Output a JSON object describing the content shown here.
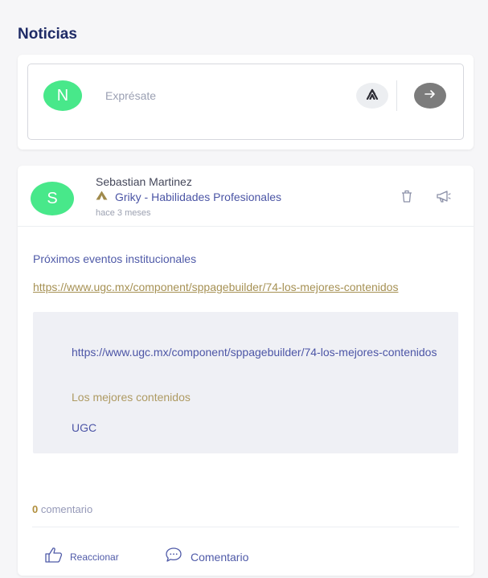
{
  "feed": {
    "title": "Noticias"
  },
  "composer": {
    "avatar_initial": "N",
    "avatar_color": "#48e88a",
    "placeholder": "Exprésate"
  },
  "post": {
    "avatar_initial": "S",
    "avatar_color": "#48e88a",
    "author": "Sebastian Martinez",
    "group": "Griky - Habilidades Profesionales",
    "time": "hace 3 meses",
    "text": "Próximos eventos institucionales",
    "link": "https://www.ugc.mx/component/sppagebuilder/74-los-mejores-contenidos",
    "preview": {
      "url": "https://www.ugc.mx/component/sppagebuilder/74-los-mejores-contenidos",
      "title": "Los mejores contenidos",
      "site": "UGC"
    },
    "comments": {
      "count": "0",
      "label": "comentario"
    },
    "actions": {
      "react": "Reaccionar",
      "comment": "Comentario"
    }
  },
  "colors": {
    "accent": "#4f5aa8",
    "title": "#1f2b66",
    "gold": "#a69154"
  }
}
